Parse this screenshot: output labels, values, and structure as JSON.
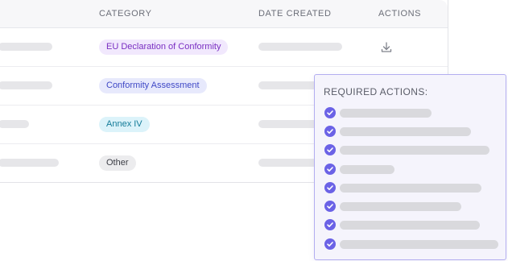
{
  "table": {
    "headers": {
      "category": "CATEGORY",
      "date_created": "DATE CREATED",
      "actions": "ACTIONS"
    },
    "rows": [
      {
        "category": "EU Declaration of Conformity",
        "badge_bg": "#f1e8fd",
        "badge_fg": "#7a2fc2",
        "action_icon": "download-icon"
      },
      {
        "category": "Conformity Assessment",
        "badge_bg": "#e7e9fc",
        "badge_fg": "#3f48c6"
      },
      {
        "category": "Annex IV",
        "badge_bg": "#dcf3fa",
        "badge_fg": "#137b98"
      },
      {
        "category": "Other",
        "badge_bg": "#ececee",
        "badge_fg": "#3b3d45"
      }
    ]
  },
  "required_actions": {
    "title": "REQUIRED ACTIONS:",
    "check_icon": "check-circle-icon",
    "accent": "#6b62e6",
    "item_count": 8
  },
  "colors": {
    "border": "#b3aef0",
    "panel_bg": "#f5f4fc",
    "placeholder": "#e6e6e9"
  }
}
